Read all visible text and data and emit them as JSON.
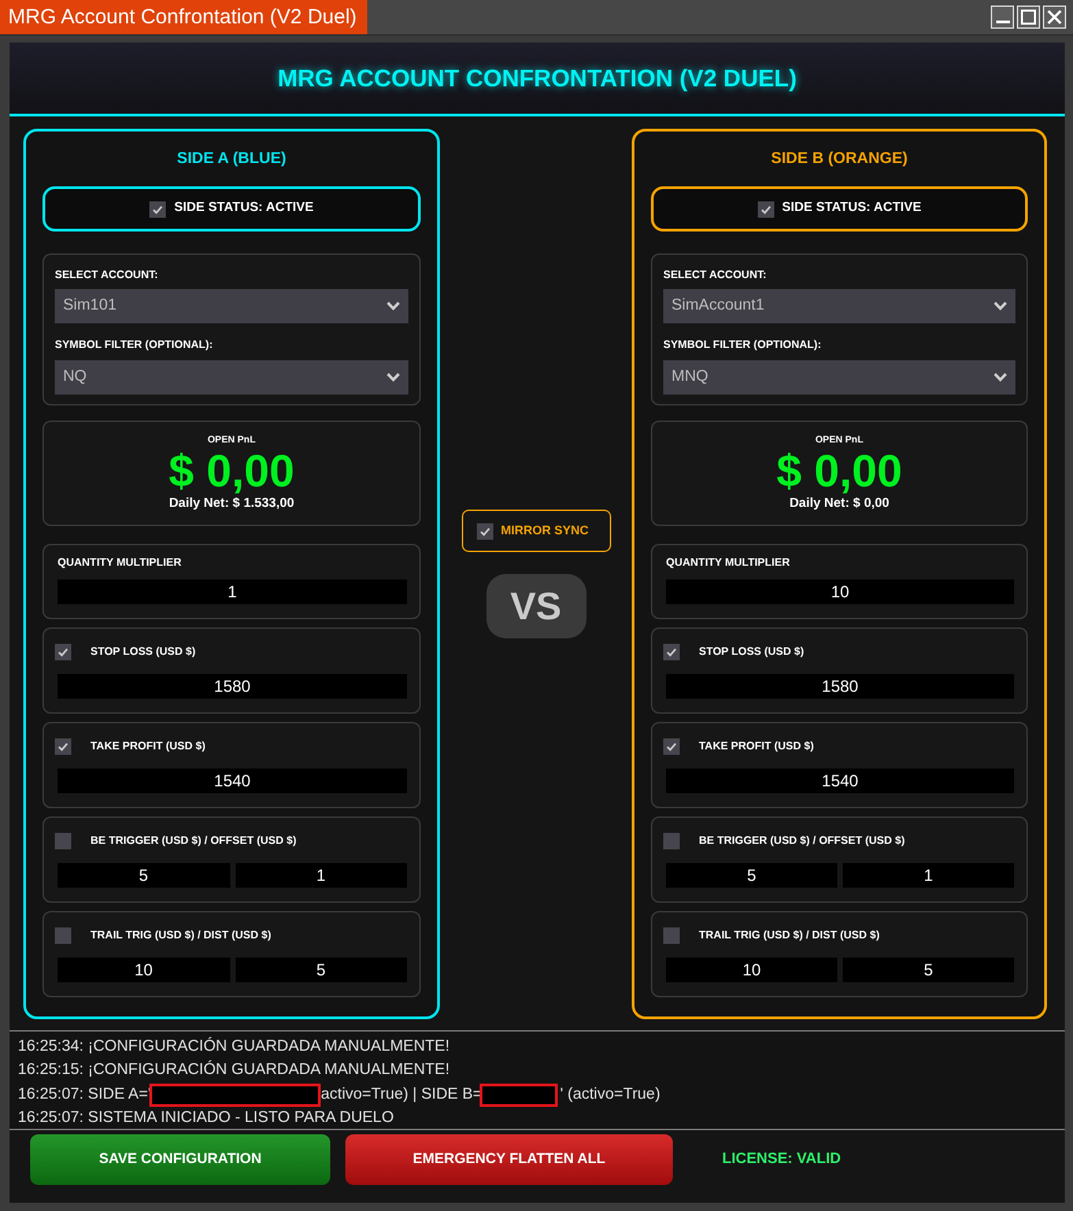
{
  "window": {
    "title": "MRG Account Confrontation (V2 Duel)"
  },
  "header": {
    "title": "MRG ACCOUNT CONFRONTATION (V2 DUEL)"
  },
  "sides": [
    {
      "title": "SIDE A (BLUE)",
      "color": "#00e5ee",
      "status": {
        "label": "SIDE STATUS: ACTIVE",
        "checked": true
      },
      "account": {
        "label": "SELECT ACCOUNT:",
        "value": "Sim101"
      },
      "symbol": {
        "label": "SYMBOL FILTER (OPTIONAL):",
        "value": "NQ"
      },
      "pnl": {
        "label": "OPEN PnL",
        "value": "$ 0,00",
        "daily_net": "Daily Net: $ 1.533,00"
      },
      "settings": [
        {
          "kind": "plain",
          "label": "QUANTITY MULTIPLIER",
          "values": [
            "1"
          ]
        },
        {
          "kind": "toggle",
          "label": "STOP LOSS (USD $)",
          "checked": true,
          "values": [
            "1580"
          ]
        },
        {
          "kind": "toggle",
          "label": "TAKE PROFIT (USD $)",
          "checked": true,
          "values": [
            "1540"
          ]
        },
        {
          "kind": "toggle",
          "label": "BE TRIGGER (USD $) / OFFSET (USD $)",
          "checked": false,
          "values": [
            "5",
            "1"
          ]
        },
        {
          "kind": "toggle",
          "label": "TRAIL TRIG (USD $) / DIST (USD $)",
          "checked": false,
          "values": [
            "10",
            "5"
          ]
        }
      ]
    },
    {
      "title": "SIDE B (ORANGE)",
      "color": "#f5a300",
      "status": {
        "label": "SIDE STATUS: ACTIVE",
        "checked": true
      },
      "account": {
        "label": "SELECT ACCOUNT:",
        "value": "SimAccount1"
      },
      "symbol": {
        "label": "SYMBOL FILTER (OPTIONAL):",
        "value": "MNQ"
      },
      "pnl": {
        "label": "OPEN PnL",
        "value": "$ 0,00",
        "daily_net": "Daily Net: $ 0,00"
      },
      "settings": [
        {
          "kind": "plain",
          "label": "QUANTITY MULTIPLIER",
          "values": [
            "10"
          ]
        },
        {
          "kind": "toggle",
          "label": "STOP LOSS (USD $)",
          "checked": true,
          "values": [
            "1580"
          ]
        },
        {
          "kind": "toggle",
          "label": "TAKE PROFIT (USD $)",
          "checked": true,
          "values": [
            "1540"
          ]
        },
        {
          "kind": "toggle",
          "label": "BE TRIGGER (USD $) / OFFSET (USD $)",
          "checked": false,
          "values": [
            "5",
            "1"
          ]
        },
        {
          "kind": "toggle",
          "label": "TRAIL TRIG (USD $) / DIST (USD $)",
          "checked": false,
          "values": [
            "10",
            "5"
          ]
        }
      ]
    }
  ],
  "mirror_sync": {
    "label": "MIRROR SYNC",
    "checked": true
  },
  "vs": "VS",
  "log": [
    {
      "parts": [
        {
          "kind": "text",
          "text": "16:25:34: ¡CONFIGURACIÓN GUARDADA MANUALMENTE!"
        }
      ]
    },
    {
      "parts": [
        {
          "kind": "text",
          "text": "16:25:15: ¡CONFIGURACIÓN GUARDADA MANUALMENTE!"
        }
      ]
    },
    {
      "parts": [
        {
          "kind": "text",
          "text": "16:25:07: SIDE A='"
        },
        {
          "kind": "redaction"
        },
        {
          "kind": "text",
          "text": "activo=True) | SIDE B="
        },
        {
          "kind": "redaction"
        },
        {
          "kind": "text",
          "text": "' (activo=True)"
        }
      ]
    },
    {
      "parts": [
        {
          "kind": "text",
          "text": "16:25:07: SISTEMA INICIADO - LISTO PARA DUELO"
        }
      ]
    }
  ],
  "buttons": [
    {
      "kind": "save",
      "label": "SAVE CONFIGURATION"
    },
    {
      "kind": "danger",
      "label": "EMERGENCY FLATTEN ALL"
    }
  ],
  "license": "LICENSE: VALID"
}
